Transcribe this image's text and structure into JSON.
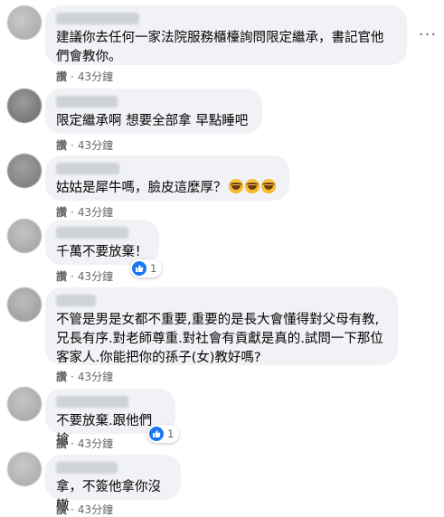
{
  "comments": [
    {
      "text": "建議你去任何一家法院服務櫃檯詢問限定繼承，書記官他們會教你。",
      "action_label": "讚",
      "separator": "·",
      "timestamp": "43分鐘",
      "has_more_button": true
    },
    {
      "text": "限定繼承啊 想要全部拿 早點睡吧",
      "action_label": "讚",
      "separator": "·",
      "timestamp": "43分鐘"
    },
    {
      "text": "姑姑是犀牛嗎，臉皮這麼厚？",
      "emojis": [
        "rolling-laugh-emoji",
        "rolling-laugh-emoji",
        "rolling-laugh-emoji"
      ],
      "action_label": "讚",
      "separator": "·",
      "timestamp": "43分鐘"
    },
    {
      "text": "千萬不要放棄！",
      "action_label": "讚",
      "separator": "·",
      "timestamp": "43分鐘",
      "reaction": {
        "icon": "like-icon",
        "count": "1",
        "color": "#1877f2"
      }
    },
    {
      "text": "不管是男是女都不重要,重要的是長大會懂得對父母有教,兄長有序.對老師尊重.對社會有貢獻是真的.試問一下那位客家人.你能把你的孫子(女)教好嗎?",
      "action_label": "讚",
      "separator": "·",
      "timestamp": "43分鐘"
    },
    {
      "text": "不要放棄.跟他們搶",
      "action_label": "讚",
      "separator": "·",
      "timestamp": "43分鐘",
      "reaction": {
        "icon": "like-icon",
        "count": "1",
        "color": "#1877f2"
      }
    },
    {
      "text": "拿，不簽他拿你沒轍",
      "action_label": "讚",
      "separator": "·",
      "timestamp": "43分鐘"
    }
  ],
  "colors": {
    "bubble": "#f0f2f5",
    "text": "#050505",
    "meta": "#65676b",
    "like_blue": "#1877f2"
  }
}
